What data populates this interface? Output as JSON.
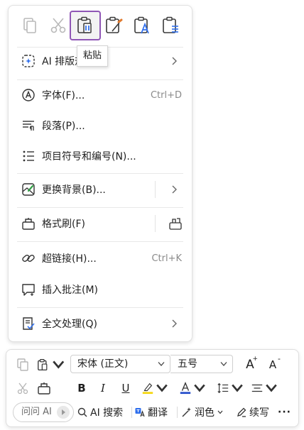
{
  "paste_toolbar": {
    "buttons": [
      {
        "icon": "copy-icon",
        "state": "disabled"
      },
      {
        "icon": "scissors-icon",
        "state": "disabled"
      },
      {
        "icon": "paste-keep-formatting-icon",
        "state": "selected"
      },
      {
        "icon": "paste-merge-format-icon",
        "state": "normal"
      },
      {
        "icon": "paste-text-only-icon",
        "state": "normal"
      },
      {
        "icon": "paste-list-icon",
        "state": "normal"
      }
    ],
    "tooltip": "粘贴"
  },
  "menu": {
    "items": [
      {
        "label": "AI 排版规则",
        "icon": "ai-sparkle-icon",
        "has_submenu": true
      },
      {
        "label": "字体(F)...",
        "icon": "font-a-icon",
        "shortcut": "Ctrl+D"
      },
      {
        "label": "段落(P)...",
        "icon": "paragraph-icon"
      },
      {
        "label": "项目符号和编号(N)...",
        "icon": "bullets-icon"
      },
      {
        "label": "更换背景(B)...",
        "icon": "background-icon",
        "has_submenu": true
      },
      {
        "label": "格式刷(F)",
        "icon": "format-painter-icon"
      },
      {
        "label": "超链接(H)...",
        "icon": "link-icon",
        "shortcut": "Ctrl+K"
      },
      {
        "label": "插入批注(M)",
        "icon": "comment-icon"
      },
      {
        "label": "全文处理(Q)",
        "icon": "document-process-icon",
        "has_submenu": true
      }
    ]
  },
  "mini_toolbar": {
    "font_name": "宋体 (正文)",
    "font_size": "五号",
    "ask_ai": "问问 AI",
    "ai_search": "AI 搜索",
    "translate": "翻译",
    "polish": "润色",
    "continue_write": "续写",
    "more": "···",
    "bold": "B",
    "italic": "I",
    "underline": "U",
    "highlight_color": "#f5d60a",
    "font_color": "#2149c9",
    "grow_font": "A",
    "shrink_font": "A"
  },
  "colors": {
    "accent_selected": "#8f56b5",
    "ai_blue": "#2f6fed"
  }
}
